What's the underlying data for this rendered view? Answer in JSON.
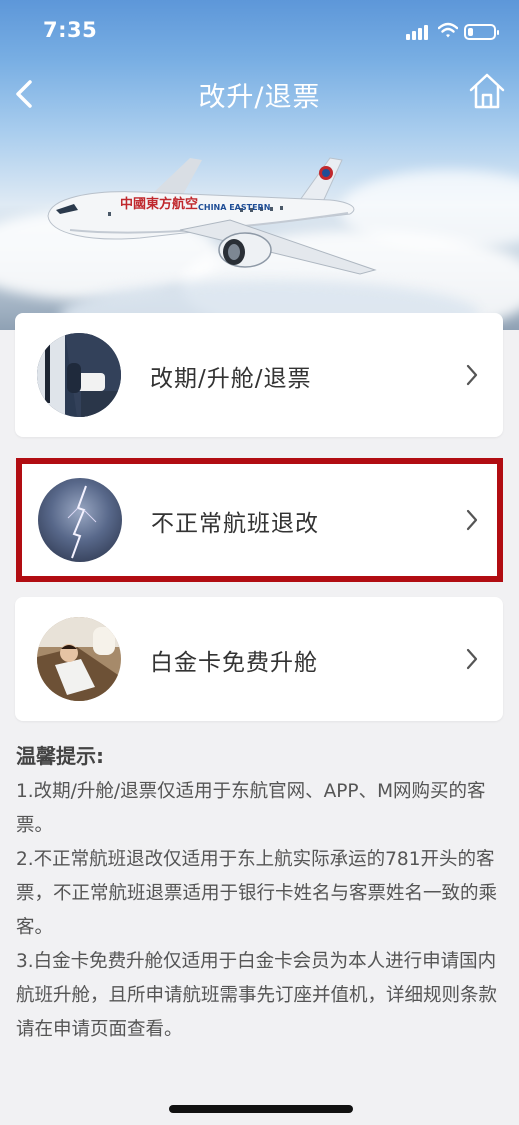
{
  "status_bar": {
    "time": "7:35"
  },
  "nav": {
    "title": "改升/退票"
  },
  "hero": {
    "airline_cn": "中國東方航空",
    "airline_en": "CHINA EASTERN"
  },
  "cards": [
    {
      "label": "改期/升舱/退票"
    },
    {
      "label": "不正常航班退改"
    },
    {
      "label": "白金卡免费升舱"
    }
  ],
  "tips": {
    "title": "温馨提示:",
    "items": [
      "1.改期/升舱/退票仅适用于东航官网、APP、M网购买的客票。",
      "2.不正常航班退改仅适用于东上航实际承运的781开头的客票，不正常航班退票适用于银行卡姓名与客票姓名一致的乘客。",
      "3.白金卡免费升舱仅适用于白金卡会员为本人进行申请国内航班升舱，且所申请航班需事先订座并值机，详细规则条款请在申请页面查看。"
    ]
  },
  "colors": {
    "highlight_border": "#b10d12",
    "header_sky": "#5d97d9"
  }
}
